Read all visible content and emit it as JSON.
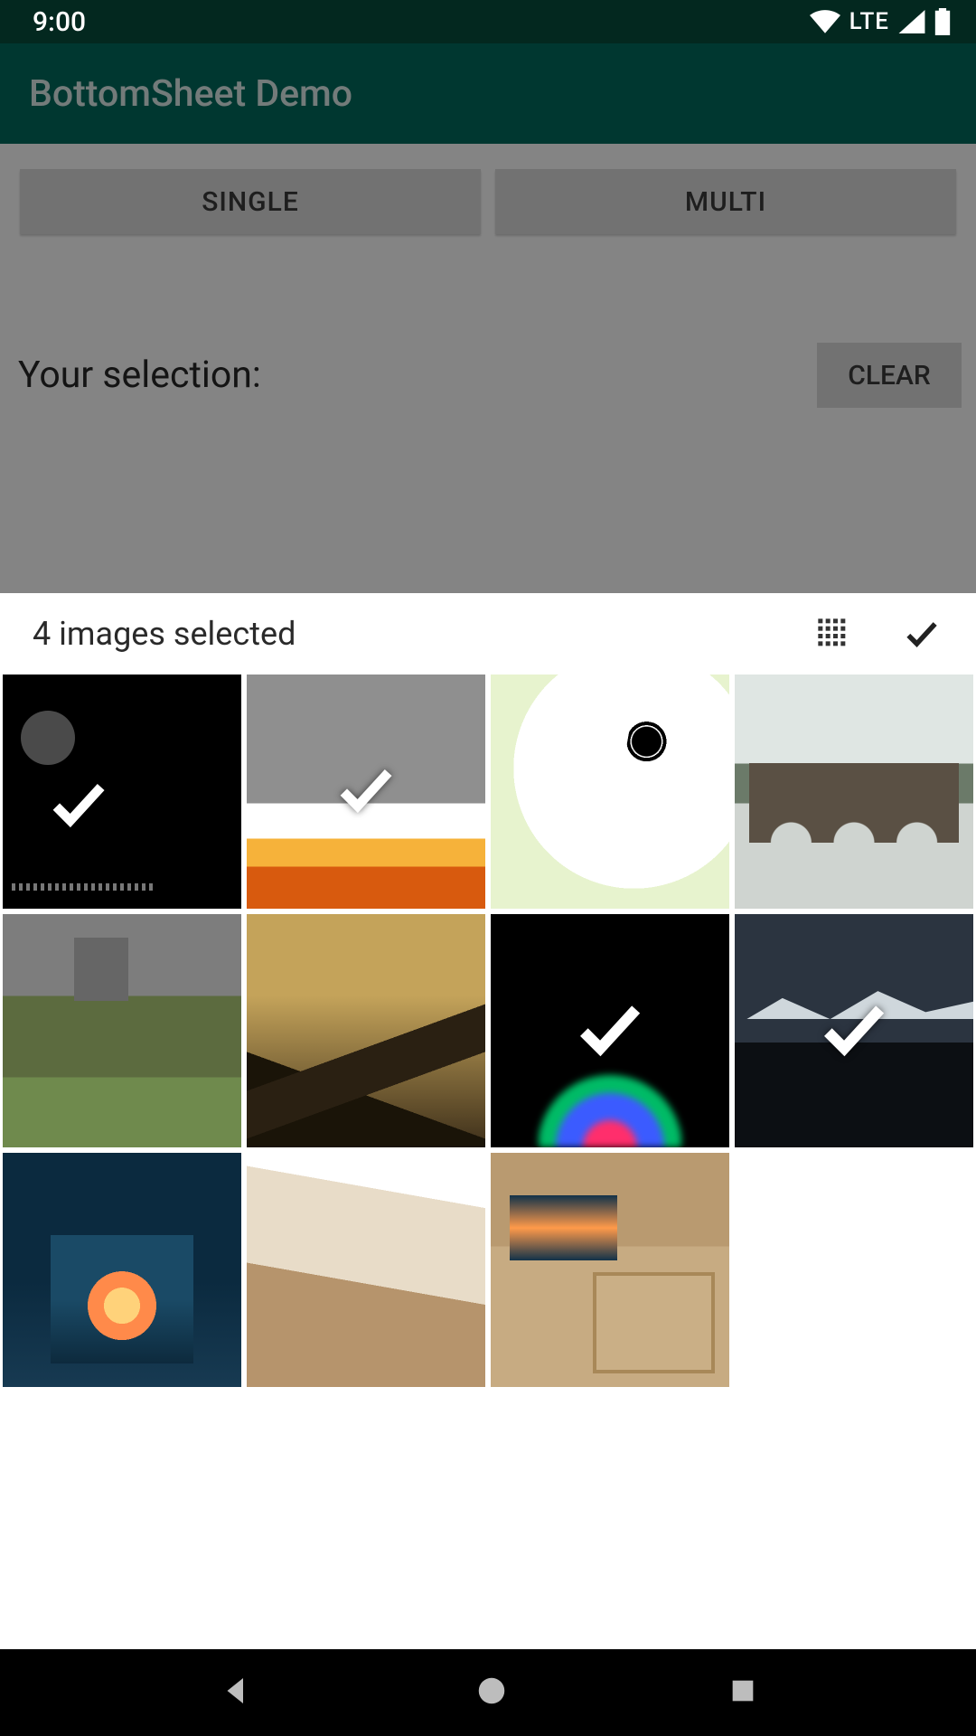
{
  "status": {
    "time": "9:00",
    "network_label": "LTE"
  },
  "appbar": {
    "title": "BottomSheet Demo"
  },
  "buttons": {
    "single": "SINGLE",
    "multi": "MULTI",
    "clear": "CLEAR"
  },
  "selection": {
    "label": "Your selection:"
  },
  "sheet": {
    "title": "4 images selected",
    "selected_count": 4,
    "items": [
      {
        "id": "img-1",
        "selected": true
      },
      {
        "id": "img-2",
        "selected": true
      },
      {
        "id": "img-3",
        "selected": false
      },
      {
        "id": "img-4",
        "selected": false
      },
      {
        "id": "img-5",
        "selected": false
      },
      {
        "id": "img-6",
        "selected": false
      },
      {
        "id": "img-7",
        "selected": true
      },
      {
        "id": "img-8",
        "selected": true
      },
      {
        "id": "img-9",
        "selected": false
      },
      {
        "id": "img-10",
        "selected": false
      },
      {
        "id": "img-11",
        "selected": false
      }
    ]
  }
}
